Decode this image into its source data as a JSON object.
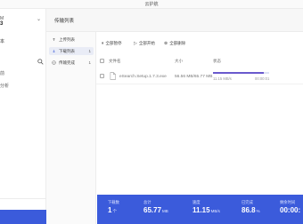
{
  "window": {
    "title": "云护航"
  },
  "sidebar": {
    "user_line1": "M",
    "user_line2": "3",
    "section_a": "本",
    "section_b": "前",
    "section_c": "分析"
  },
  "topbar": {
    "title": "传输列表"
  },
  "nav": {
    "items": [
      {
        "label": "上传列表",
        "count": ""
      },
      {
        "label": "下载列表",
        "count": "1"
      },
      {
        "label": "传输完成",
        "count": "1"
      }
    ]
  },
  "toolbar": {
    "pause_all": "全部暂停",
    "start_all": "全部开始",
    "delete_all": "全部删除"
  },
  "table": {
    "headers": [
      "文件名",
      "大小",
      "状态"
    ],
    "rows": [
      {
        "name": "eSearch.Setup.1.7.3.exe",
        "size": "56.56 MB/65.77 MB",
        "progress": 0.9,
        "speed": "11.15 MB/s",
        "remaining": "00:00:01"
      }
    ]
  },
  "stats": [
    {
      "key": "下载数",
      "value": "1",
      "unit": "个"
    },
    {
      "key": "总计",
      "value": "65.77",
      "unit": "MB"
    },
    {
      "key": "速度",
      "value": "11.15",
      "unit": "MB/s"
    },
    {
      "key": "已完成",
      "value": "86.8",
      "unit": "%"
    },
    {
      "key": "剩余时间",
      "value": "00:00:",
      "unit": ""
    }
  ],
  "colors": {
    "accent": "#3b5bdb",
    "progress": "#6a5acd"
  }
}
